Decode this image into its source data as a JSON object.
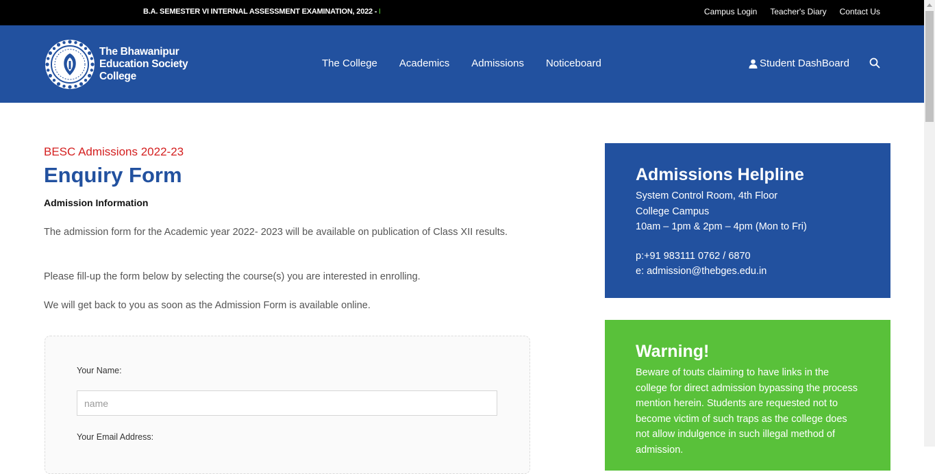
{
  "topbar": {
    "ticker_text": "B.A. SEMESTER VI INTERNAL ASSESSMENT EXAMINATION, 2022 - ",
    "ticker_highlight": "Ma",
    "links": [
      "Campus Login",
      "Teacher's Diary",
      "Contact Us"
    ]
  },
  "header": {
    "logo_lines": [
      "The Bhawanipur",
      "Education Society",
      "College"
    ],
    "nav": [
      "The College",
      "Academics",
      "Admissions",
      "Noticeboard"
    ],
    "dashboard_label": "Student DashBoard"
  },
  "main": {
    "subtitle": "BESC Admissions 2022-23",
    "title": "Enquiry Form",
    "section_heading": "Admission Information",
    "paragraphs": [
      "The admission form for the Academic year 2022- 2023 will be available on publication of Class XII results.",
      "Please fill-up the form below by selecting the course(s) you are interested in enrolling.",
      "We will get back to you as soon as the Admission Form is available online."
    ]
  },
  "form": {
    "name_label": "Your Name:",
    "name_placeholder": "name",
    "name_value": "",
    "email_label": "Your Email Address:"
  },
  "helpline": {
    "title": "Admissions Helpline",
    "lines": [
      "System Control Room, 4th Floor",
      "College Campus",
      "10am – 1pm & 2pm – 4pm (Mon to Fri)"
    ],
    "phone": "p:+91 983111 0762 / 6870",
    "email": "e: admission@thebges.edu.in"
  },
  "warning": {
    "title": "Warning!",
    "text": "Beware of touts claiming to have links in the college for direct admission bypassing the process mention herein. Students are requested not to become victim of such traps as the college does not allow indulgence in such illegal method of admission."
  },
  "colors": {
    "brand_blue": "#22519f",
    "warning_green": "#59c13a",
    "accent_red": "#d42020",
    "ticker_green": "#4dbb2f"
  }
}
